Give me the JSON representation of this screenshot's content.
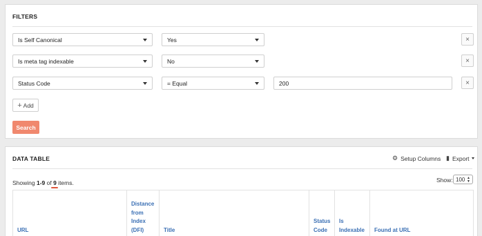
{
  "filters": {
    "title": "FILTERS",
    "rows": [
      {
        "field": "Is Self Canonical",
        "operator": "Yes",
        "value": null
      },
      {
        "field": "Is meta tag indexable",
        "operator": "No",
        "value": null
      },
      {
        "field": "Status Code",
        "operator": "= Equal",
        "value": "200"
      }
    ],
    "remove_glyph": "×",
    "add_label": "Add",
    "search_label": "Search"
  },
  "table": {
    "title": "DATA TABLE",
    "setup_columns": "Setup Columns",
    "export": "Export",
    "showing_prefix": "Showing ",
    "range": "1-9",
    "of": " of ",
    "total": "9",
    "suffix": " items.",
    "show_label": "Show:",
    "page_size": "100",
    "columns": [
      "URL",
      "Distance from Index (DFI)",
      "Title",
      "Status Code",
      "Is Indexable",
      "Found at URL"
    ]
  }
}
